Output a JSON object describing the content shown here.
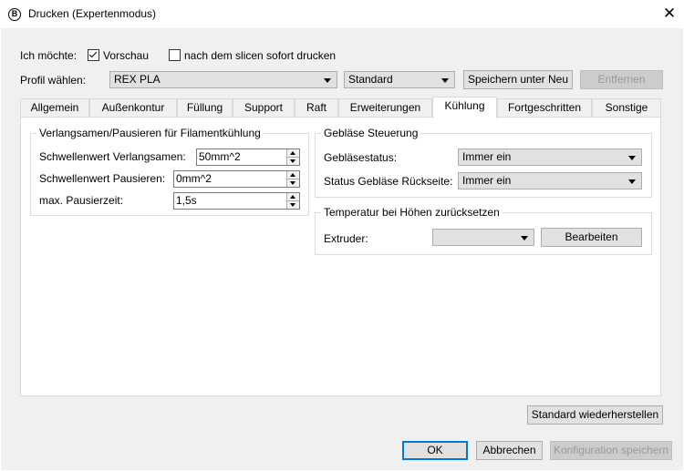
{
  "window": {
    "title": "Drucken (Expertenmodus)",
    "app_icon": "B",
    "close_glyph": "✕"
  },
  "top": {
    "want_label": "Ich möchte:",
    "preview_label": "Vorschau",
    "preview_checked": true,
    "print_after_slice_label": "nach dem slicen sofort drucken",
    "print_after_slice_checked": false,
    "profile_label": "Profil wählen:",
    "profile_value": "REX PLA",
    "preset_value": "Standard",
    "save_as_label": "Speichern unter Neu",
    "remove_label": "Entfernen"
  },
  "tabs": [
    {
      "label": "Allgemein",
      "active": false
    },
    {
      "label": "Außenkontur",
      "active": false
    },
    {
      "label": "Füllung",
      "active": false
    },
    {
      "label": "Support",
      "active": false
    },
    {
      "label": "Raft",
      "active": false
    },
    {
      "label": "Erweiterungen",
      "active": false
    },
    {
      "label": "Kühlung",
      "active": true
    },
    {
      "label": "Fortgeschritten",
      "active": false
    },
    {
      "label": "Sonstige",
      "active": false
    }
  ],
  "cooling": {
    "slowdown_group": {
      "title": "Verlangsamen/Pausieren für Filamentkühlung",
      "slowdown_threshold_label": "Schwellenwert Verlangsamen:",
      "slowdown_threshold_value": "50mm^2",
      "pause_threshold_label": "Schwellenwert Pausieren:",
      "pause_threshold_value": "0mm^2",
      "max_pause_label": "max. Pausierzeit:",
      "max_pause_value": "1,5s"
    },
    "fan_group": {
      "title": "Gebläse Steuerung",
      "fan_status_label": "Gebläsestatus:",
      "fan_status_value": "Immer ein",
      "rear_fan_label": "Status Gebläse Rückseite:",
      "rear_fan_value": "Immer ein"
    },
    "temp_group": {
      "title": "Temperatur bei Höhen zurücksetzen",
      "extruder_label": "Extruder:",
      "extruder_value": "",
      "edit_label": "Bearbeiten"
    }
  },
  "footer": {
    "restore_label": "Standard wiederherstellen",
    "ok_label": "OK",
    "cancel_label": "Abbrechen",
    "save_config_label": "Konfiguration speichern"
  }
}
